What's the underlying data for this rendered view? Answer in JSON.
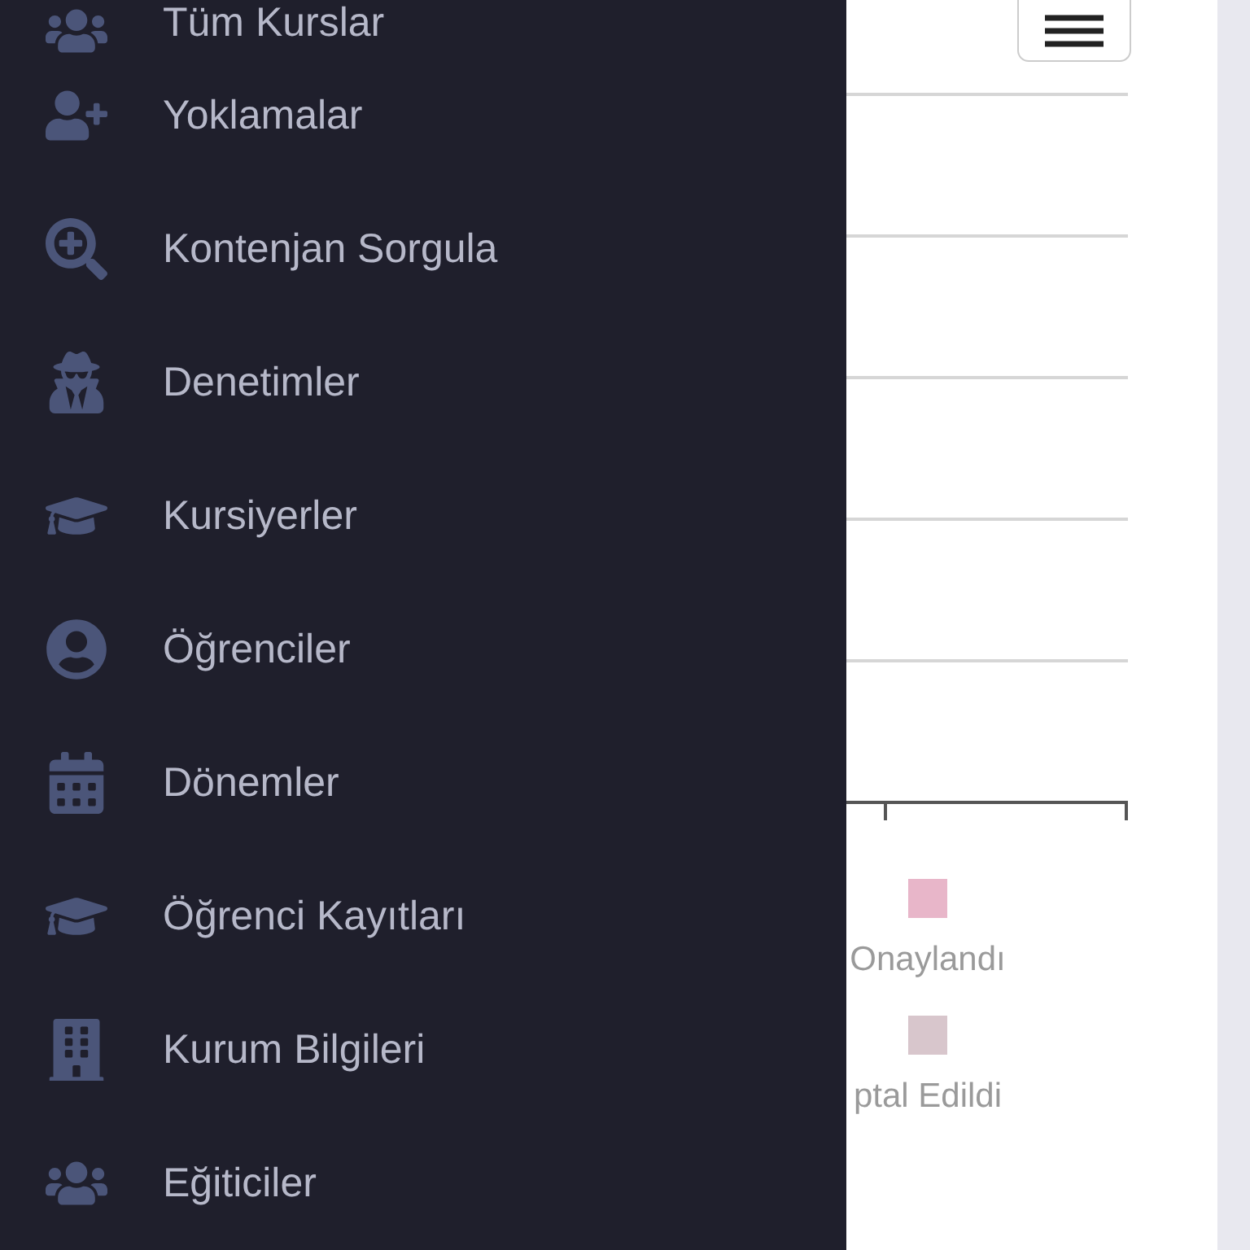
{
  "drawer": {
    "items": [
      {
        "label": "Tüm Kurslar"
      },
      {
        "label": "Yoklamalar"
      },
      {
        "label": "Kontenjan Sorgula"
      },
      {
        "label": "Denetimler"
      },
      {
        "label": "Kursiyerler"
      },
      {
        "label": "Öğrenciler"
      },
      {
        "label": "Dönemler"
      },
      {
        "label": "Öğrenci Kayıtları"
      },
      {
        "label": "Kurum Bilgileri"
      },
      {
        "label": "Eğiticiler"
      }
    ]
  },
  "chart": {
    "legend": [
      {
        "label": "Onaylandı",
        "color": "#e8b6c9"
      },
      {
        "label": "ptal Edildi",
        "color": "#d8c6cc"
      }
    ]
  }
}
